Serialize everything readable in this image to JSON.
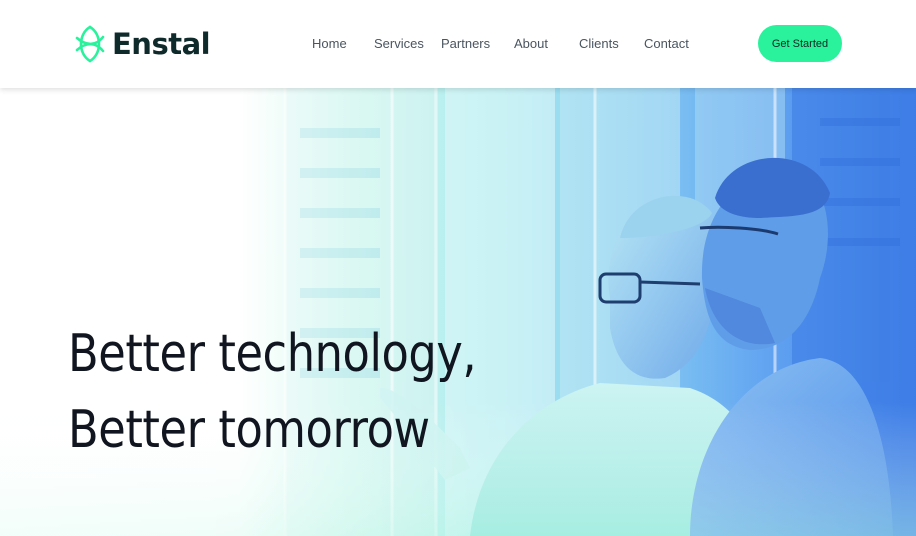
{
  "brand": {
    "name": "Enstal",
    "logo_icon": "leaf-knot-icon"
  },
  "nav": {
    "items": [
      {
        "label": "Home"
      },
      {
        "label": "Services"
      },
      {
        "label": "Partners"
      },
      {
        "label": "About"
      },
      {
        "label": "Clients"
      },
      {
        "label": "Contact"
      }
    ],
    "cta_label": "Get Started"
  },
  "hero": {
    "headline_line1": "Better technology,",
    "headline_line2": "Better tomorrow",
    "image_alt": "two-men-in-server-room"
  },
  "colors": {
    "accent": "#2af29c",
    "brand_text": "#0f2a2b",
    "headline": "#10151f",
    "nav_text": "#4a5560",
    "photo_blue": "#3f7fe6",
    "photo_teal": "#8ef0d9"
  }
}
